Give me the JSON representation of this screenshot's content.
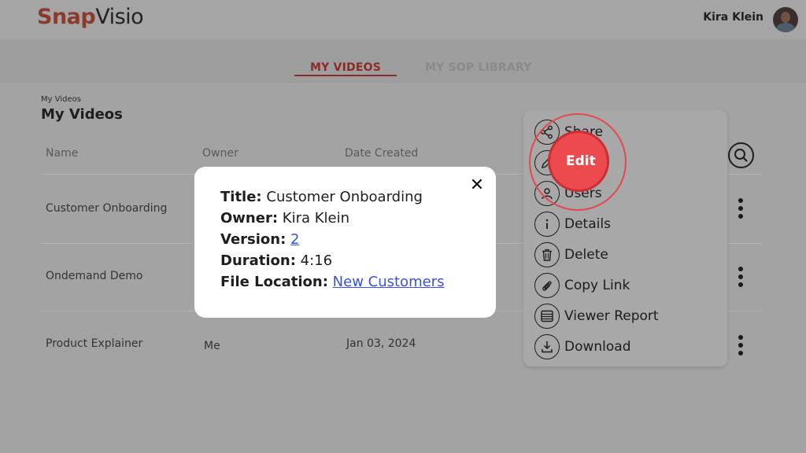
{
  "brand": {
    "snap": "Snap",
    "visio": "Visio"
  },
  "user": {
    "name": "Kira Klein"
  },
  "tabs": [
    {
      "label": "MY VIDEOS",
      "active": true
    },
    {
      "label": "MY SOP LIBRARY",
      "active": false
    }
  ],
  "breadcrumb": "My Videos",
  "page_title": "My Videos",
  "table": {
    "headers": [
      "Name",
      "Owner",
      "Date Created"
    ],
    "rows": [
      {
        "name": "Customer Onboarding",
        "owner": "",
        "date": ""
      },
      {
        "name": "Ondemand Demo",
        "owner": "",
        "date": ""
      },
      {
        "name": "Product Explainer",
        "owner": "Me",
        "date": "Jan 03, 2024"
      }
    ]
  },
  "menu": {
    "items": [
      {
        "label": "Share",
        "icon": "share-icon"
      },
      {
        "label": "Edit",
        "icon": "pencil-icon"
      },
      {
        "label": "Users",
        "icon": "user-icon"
      },
      {
        "label": "Details",
        "icon": "info-icon"
      },
      {
        "label": "Delete",
        "icon": "trash-icon"
      },
      {
        "label": "Copy Link",
        "icon": "paperclip-icon"
      },
      {
        "label": "Viewer Report",
        "icon": "report-icon"
      },
      {
        "label": "Download",
        "icon": "download-icon"
      }
    ]
  },
  "dialog": {
    "title_label": "Title:",
    "title_value": "Customer Onboarding",
    "owner_label": "Owner:",
    "owner_value": "Kira Klein",
    "version_label": "Version:",
    "version_value": "2",
    "duration_label": "Duration:",
    "duration_value": "4:16",
    "location_label": "File Location:",
    "location_value": "New Customers"
  },
  "colors": {
    "accent": "#8e2a26",
    "highlight": "#ec4a4f",
    "link": "#3a52d9"
  }
}
